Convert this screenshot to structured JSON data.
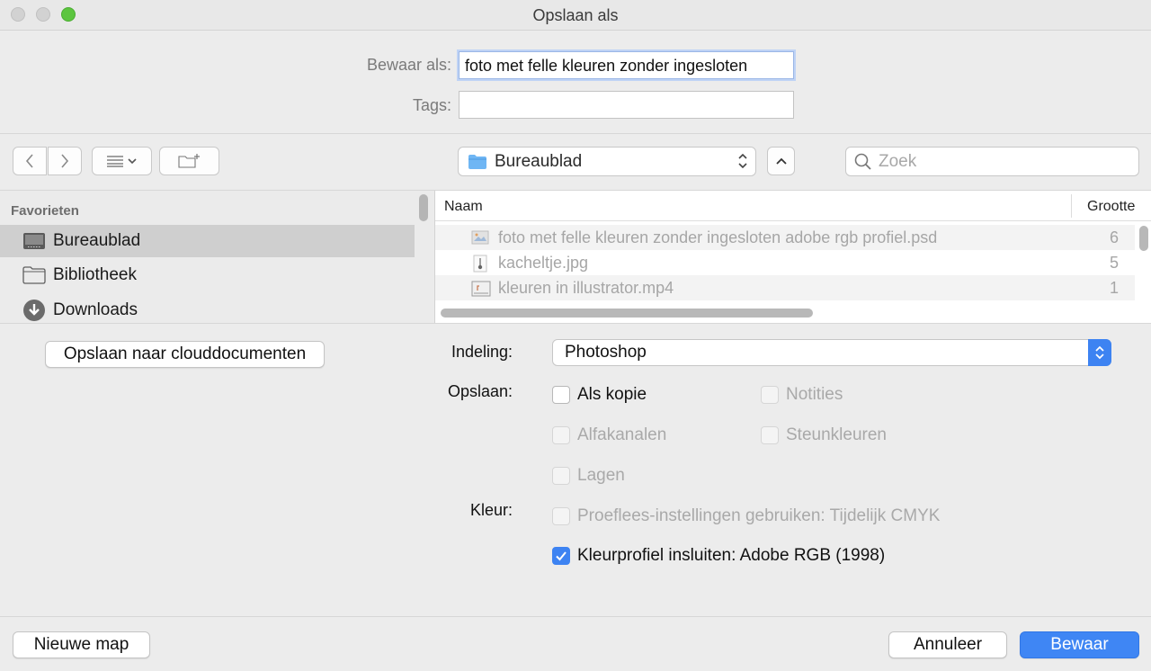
{
  "window": {
    "title": "Opslaan als"
  },
  "save": {
    "name_label": "Bewaar als:",
    "name_value": "foto met felle kleuren zonder ingesloten",
    "tags_label": "Tags:",
    "tags_value": ""
  },
  "toolbar": {
    "location": "Bureaublad",
    "search_placeholder": "Zoek"
  },
  "sidebar": {
    "section": "Favorieten",
    "items": [
      {
        "label": "Bureaublad",
        "icon": "desktop-icon",
        "selected": true
      },
      {
        "label": "Bibliotheek",
        "icon": "folder-icon",
        "selected": false
      },
      {
        "label": "Downloads",
        "icon": "download-icon",
        "selected": false
      }
    ]
  },
  "files": {
    "columns": [
      "Naam",
      "Grootte"
    ],
    "rows": [
      {
        "name": "foto met felle kleuren zonder ingesloten adobe rgb profiel.psd",
        "size": "6",
        "icon": "image-file-icon"
      },
      {
        "name": "kacheltje.jpg",
        "size": "5",
        "icon": "jpg-file-icon"
      },
      {
        "name": "kleuren in illustrator.mp4",
        "size": "1",
        "icon": "video-file-icon"
      }
    ]
  },
  "options": {
    "cloud_button": "Opslaan naar clouddocumenten",
    "format_label": "Indeling:",
    "format_value": "Photoshop",
    "save_label": "Opslaan:",
    "as_copy": "Als kopie",
    "notes": "Notities",
    "alpha_channels": "Alfakanalen",
    "spot_colors": "Steunkleuren",
    "layers": "Lagen",
    "color_label": "Kleur:",
    "proof_setup": "Proeflees-instellingen gebruiken: Tijdelijk CMYK",
    "embed_profile": "Kleurprofiel insluiten: Adobe RGB (1998)"
  },
  "buttons": {
    "new_folder": "Nieuwe map",
    "cancel": "Annuleer",
    "save": "Bewaar"
  },
  "colors": {
    "accent": "#3f86f4",
    "zoom_button": "#5cc53f"
  }
}
